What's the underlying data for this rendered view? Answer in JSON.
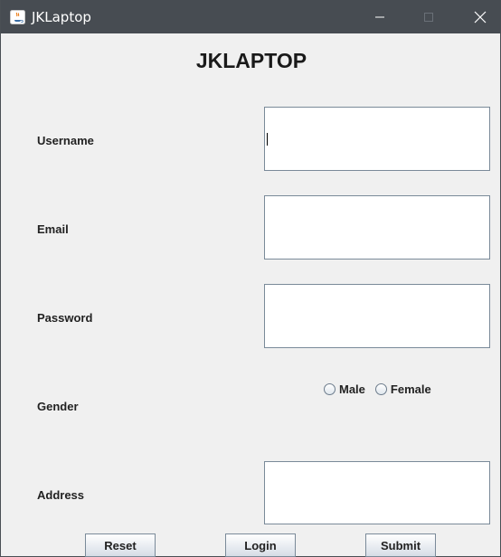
{
  "window": {
    "title": "JKLaptop",
    "title_icon": "java-icon"
  },
  "form": {
    "heading": "JKLAPTOP",
    "username_label": "Username",
    "username_value": "",
    "email_label": "Email",
    "email_value": "",
    "password_label": "Password",
    "password_value": "",
    "gender_label": "Gender",
    "gender_options": [
      "Male",
      "Female"
    ],
    "gender_selected": null,
    "address_label": "Address",
    "address_value": ""
  },
  "buttons": {
    "reset": "Reset",
    "login": "Login",
    "submit": "Submit"
  },
  "colors": {
    "titlebar": "#474c52",
    "window_bg": "#f0f0f0",
    "field_border": "#7a8a99"
  }
}
